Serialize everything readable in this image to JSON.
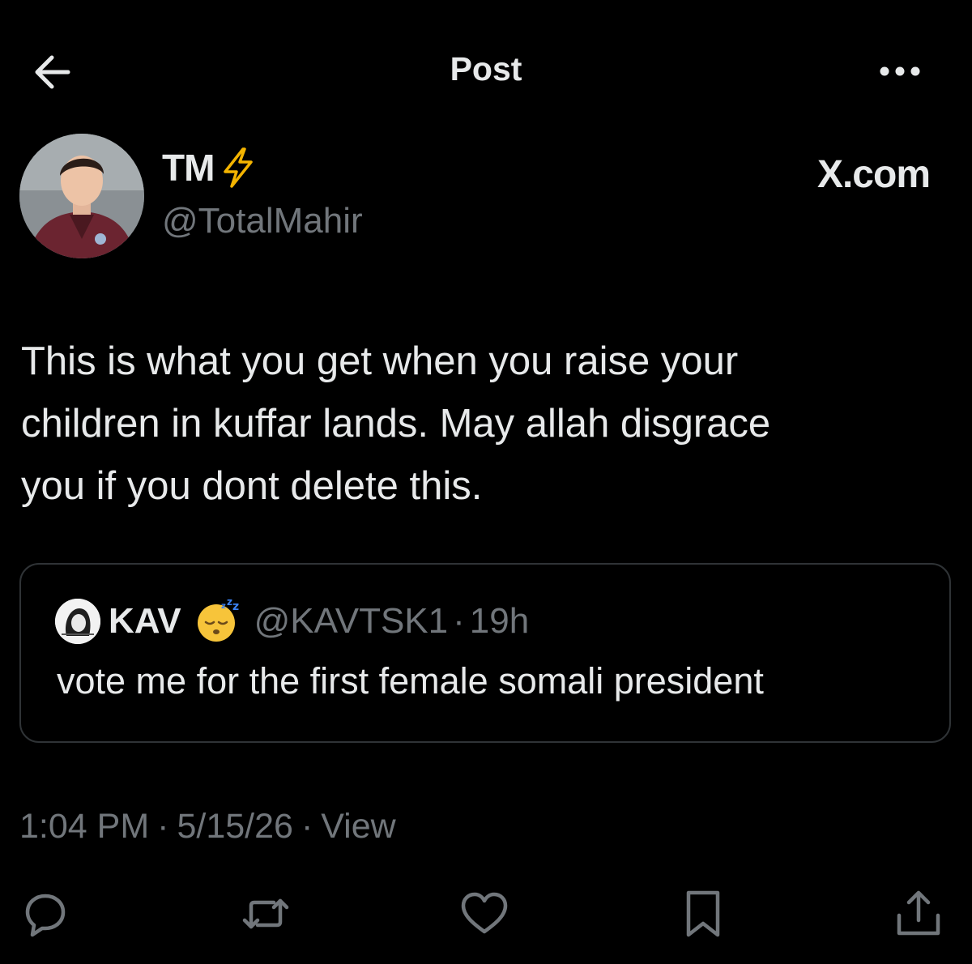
{
  "header": {
    "title": "Post",
    "back_icon": "arrow-left-icon",
    "more_icon": "more-horizontal-icon"
  },
  "author": {
    "name": "TM",
    "badge_icon": "lightning-bolt-icon",
    "handle": "@TotalMahir",
    "source": "X.com"
  },
  "post": {
    "text": "This is what you get when you raise your\nchildren in kuffar lands. May allah disgrace\nyou if you dont delete this."
  },
  "quote": {
    "name": "KAV",
    "emoji_icon": "sleeping-face-emoji",
    "handle": "@KAVTSK1",
    "separator": "·",
    "time": "19h",
    "text": "vote me for the first female somali president"
  },
  "meta": {
    "time": "1:04 PM",
    "date": "5/15/26",
    "views_label": "View",
    "separator": "·"
  },
  "actions": {
    "reply_icon": "reply-icon",
    "repost_icon": "repost-icon",
    "like_icon": "heart-icon",
    "bookmark_icon": "bookmark-icon",
    "share_icon": "share-icon"
  },
  "colors": {
    "background": "#000000",
    "text_primary": "#e7e9ea",
    "text_secondary": "#71767b",
    "border": "#2f3336",
    "bolt": "#f4b400"
  }
}
